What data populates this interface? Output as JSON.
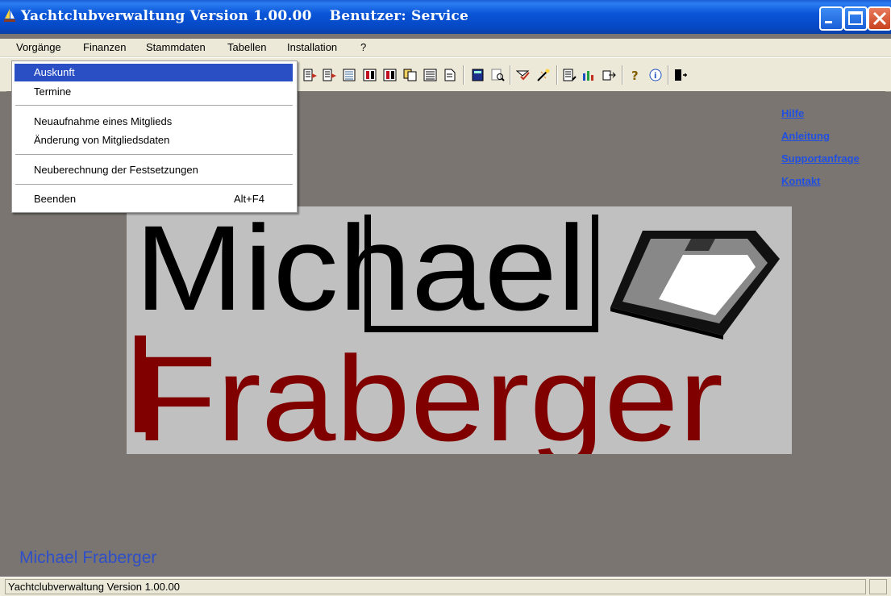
{
  "window": {
    "title": "Yachtclubverwaltung Version 1.00.00",
    "user_label": "Benutzer: Service",
    "controls": [
      "minimize-icon",
      "maximize-icon",
      "close-icon"
    ]
  },
  "menubar": {
    "items": [
      {
        "label": "Vorgänge"
      },
      {
        "label": "Finanzen"
      },
      {
        "label": "Stammdaten"
      },
      {
        "label": "Tabellen"
      },
      {
        "label": "Installation"
      },
      {
        "label": "?"
      }
    ]
  },
  "menu_vorgaenge": {
    "items": [
      {
        "label": "Auskunft",
        "shortcut": "",
        "selected": true
      },
      {
        "label": "Termine",
        "shortcut": ""
      },
      {
        "label": "Neuaufnahme eines Mitglieds",
        "shortcut": ""
      },
      {
        "label": "Änderung von Mitgliedsdaten",
        "shortcut": ""
      },
      {
        "label": "Neuberechnung der Festsetzungen",
        "shortcut": ""
      },
      {
        "label": "Beenden",
        "shortcut": "Alt+F4"
      }
    ]
  },
  "toolbar": {
    "icons": [
      "report-export-icon",
      "report-export-icon",
      "report-list-icon",
      "table-red-icon",
      "table-red-icon",
      "copy-icon",
      "list-icon",
      "document-icon",
      "calculator-icon",
      "print-preview-icon",
      "mail-check-icon",
      "wizard-icon",
      "list-edit-icon",
      "chart-edit-icon",
      "export-icon",
      "help-icon",
      "info-icon",
      "exit-door-icon"
    ]
  },
  "links": [
    {
      "label": "Hilfe"
    },
    {
      "label": "Anleitung"
    },
    {
      "label": "Supportanfrage"
    },
    {
      "label": "Kontakt"
    }
  ],
  "logo": {
    "line1": "Michael",
    "line2": "Fraberger",
    "colors": {
      "line1": "#000000",
      "line2": "#800000",
      "panel": "#c0c0c0"
    }
  },
  "footer_name": "Michael Fraberger",
  "statusbar": {
    "text": "Yachtclubverwaltung Version 1.00.00"
  },
  "colors": {
    "titlebar": "#0a55d8",
    "selection": "#2a4fc4",
    "link": "#2150e0",
    "workspace": "#7a7571",
    "chrome": "#ece9d8"
  }
}
